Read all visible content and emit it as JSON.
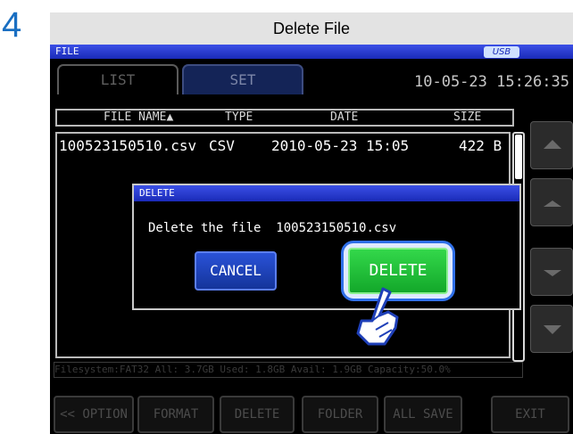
{
  "step_number": "4",
  "caption": "Delete File",
  "screen": {
    "title": "FILE",
    "usb_badge": "USB",
    "tabs": [
      {
        "label": "LIST"
      },
      {
        "label": "SET"
      }
    ],
    "datetime": "10-05-23 15:26:35",
    "columns": [
      "FILE NAME▲",
      "TYPE",
      "DATE",
      "SIZE"
    ],
    "files": [
      {
        "name": "100523150510.csv",
        "type": "CSV",
        "date": "2010-05-23 15:05",
        "size": "422 B"
      }
    ],
    "status": "Filesystem:FAT32 All: 3.7GB Used: 1.8GB Avail: 1.9GB Capacity:50.0%",
    "function_buttons": [
      "<< OPTION",
      "FORMAT",
      "DELETE",
      "FOLDER",
      "ALL SAVE",
      "EXIT"
    ]
  },
  "dialog": {
    "title": "DELETE",
    "message_prefix": "Delete the file",
    "filename": "100523150510.csv",
    "cancel_label": "CANCEL",
    "delete_label": "DELETE"
  },
  "colors": {
    "title_bar": "#2536d0",
    "delete_button": "#22c23a",
    "cancel_button": "#1e44c0",
    "step_number": "#1a6fc2"
  }
}
